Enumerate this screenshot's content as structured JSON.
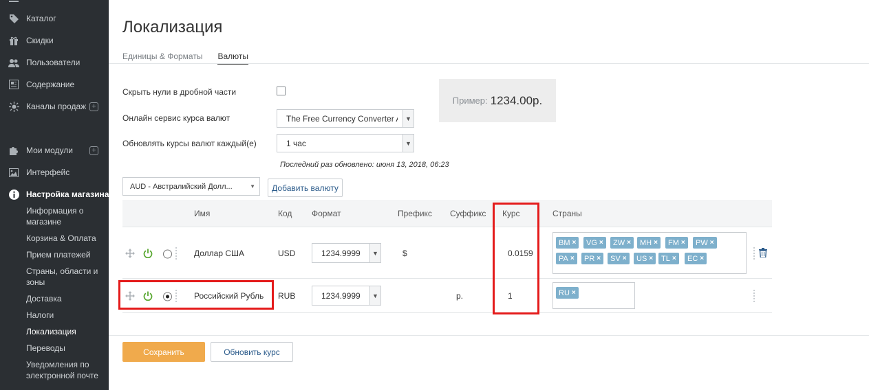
{
  "sidebar": {
    "items": [
      {
        "label": "Каталог",
        "icon": "tags-icon"
      },
      {
        "label": "Скидки",
        "icon": "gift-icon"
      },
      {
        "label": "Пользователи",
        "icon": "users-icon"
      },
      {
        "label": "Содержание",
        "icon": "content-icon"
      },
      {
        "label": "Каналы продаж",
        "icon": "sun-icon"
      },
      {
        "label": "Мои модули",
        "icon": "puzzle-icon"
      },
      {
        "label": "Интерфейс",
        "icon": "image-icon"
      },
      {
        "label": "Настройка магазина",
        "icon": "info-icon"
      }
    ],
    "subitems": [
      "Информация о магазине",
      "Корзина & Оплата",
      "Прием платежей",
      "Страны, области и зоны",
      "Доставка",
      "Налоги",
      "Локализация",
      "Переводы",
      "Уведомления по электронной почте"
    ]
  },
  "page": {
    "title": "Локализация"
  },
  "tabs": [
    "Единицы & Форматы",
    "Валюты"
  ],
  "settings": {
    "hide_zeros_label": "Скрыть нули в дробной части",
    "online_service_label": "Онлайн сервис курса валют",
    "online_service_value": "The Free Currency Converter A",
    "update_every_label": "Обновлять курсы валют каждый(е)",
    "update_every_value": "1 час",
    "last_updated": "Последний раз обновлено: июня 13, 2018, 06:23",
    "preview_label": "Пример:",
    "preview_value": "1234.00р."
  },
  "add_currency": {
    "select_value": "AUD - Австралийский Долл...",
    "button_label": "Добавить валюту"
  },
  "table": {
    "headers": {
      "name": "Имя",
      "code": "Код",
      "format": "Формат",
      "prefix": "Префикс",
      "suffix": "Суффикс",
      "rate": "Курс",
      "countries": "Страны"
    },
    "rows": [
      {
        "name": "Доллар США",
        "code": "USD",
        "format": "1234.9999",
        "prefix": "$",
        "suffix": "",
        "rate": "0.0159",
        "default": false,
        "countries": [
          "BM",
          "VG",
          "ZW",
          "MH",
          "FM",
          "PW",
          "PA",
          "PR",
          "SV",
          "US",
          "TL",
          "EC"
        ]
      },
      {
        "name": "Российский Рубль",
        "code": "RUB",
        "format": "1234.9999",
        "prefix": "",
        "suffix": "р.",
        "rate": "1",
        "default": true,
        "countries": [
          "RU"
        ]
      }
    ]
  },
  "actions": {
    "save_label": "Сохранить",
    "refresh_label": "Обновить курс"
  },
  "colors": {
    "sidebar_bg": "#2b2f33",
    "save_button": "#f0aa4c",
    "tag": "#7eb0cc",
    "highlight": "#e41b1b",
    "power_on": "#5aa832"
  }
}
